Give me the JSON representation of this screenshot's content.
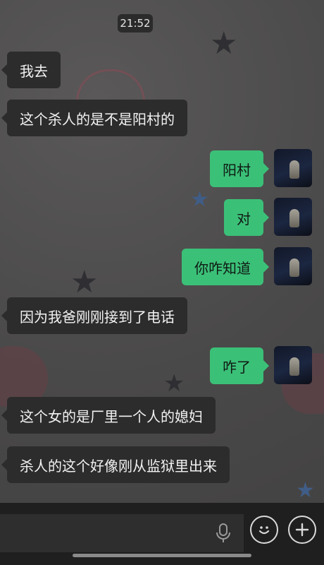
{
  "status": {
    "time": "21:52"
  },
  "messages": [
    {
      "direction": "in",
      "text": "我去"
    },
    {
      "direction": "in",
      "text": "这个杀人的是不是阳村的"
    },
    {
      "direction": "out",
      "text": "阳村"
    },
    {
      "direction": "out",
      "text": "对"
    },
    {
      "direction": "out",
      "text": "你咋知道"
    },
    {
      "direction": "in",
      "text": "因为我爸刚刚接到了电话"
    },
    {
      "direction": "out",
      "text": "咋了"
    },
    {
      "direction": "in",
      "text": "这个女的是厂里一个人的媳妇"
    },
    {
      "direction": "in",
      "text": "杀人的这个好像刚从监狱里出来"
    }
  ],
  "input_bar": {
    "value": "",
    "icons": {
      "voice": "microphone-icon",
      "emoji": "emoji-icon",
      "more": "plus-icon"
    }
  },
  "colors": {
    "outgoing_bubble": "#3bc078",
    "incoming_bubble": "#2c2c2c",
    "background": "#4b4a4a"
  }
}
